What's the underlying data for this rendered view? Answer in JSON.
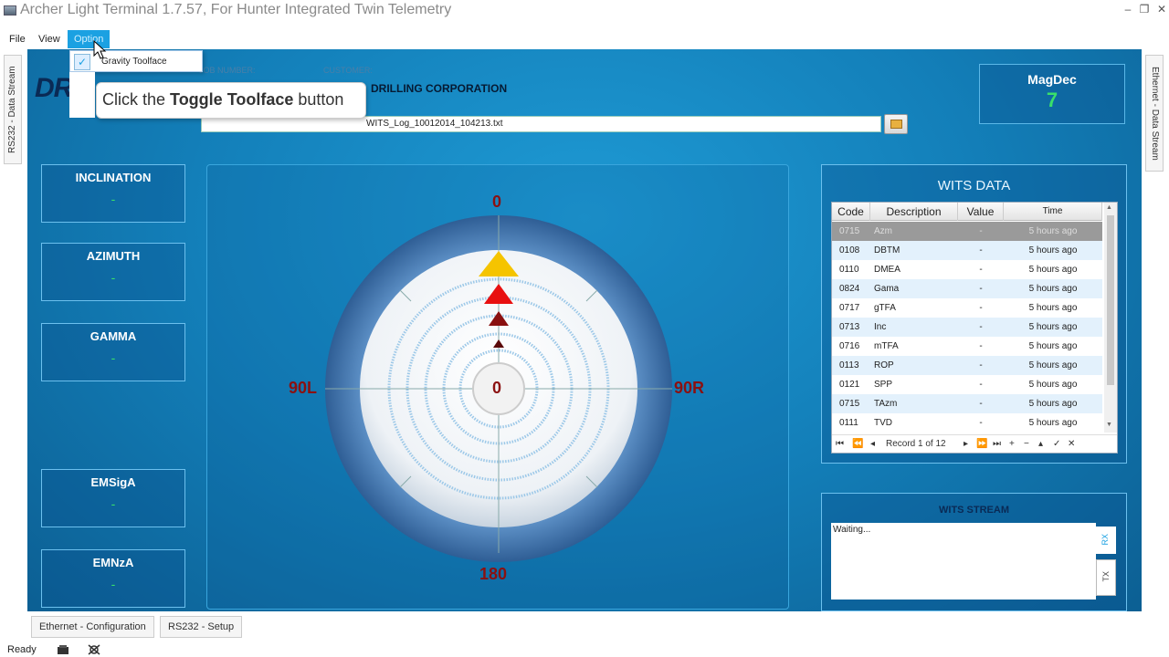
{
  "window": {
    "title": "Archer Light Terminal 1.7.57, For Hunter Integrated Twin Telemetry",
    "controls": [
      "–",
      "❐",
      "✕"
    ]
  },
  "menu": {
    "file": "File",
    "view": "View",
    "option": "Option"
  },
  "option_menu": {
    "item": "Gravity Toolface",
    "checked": true
  },
  "tooltip": {
    "prefix": "Click the ",
    "bold": "Toggle Toolface",
    "suffix": " button"
  },
  "side_tabs": {
    "left": "RS232 - Data Stream",
    "right": "Ethernet - Data Stream"
  },
  "header": {
    "logo_text": "DR",
    "job_number_label": "JOB NUMBER:",
    "customer_label": "CUSTOMER:",
    "customer_value": "DRILLING CORPORATION",
    "log_file": "WITS_Log_10012014_104213.txt"
  },
  "magdec": {
    "label": "MagDec",
    "value": "7"
  },
  "panels": [
    {
      "label": "INCLINATION",
      "value": "-"
    },
    {
      "label": "AZIMUTH",
      "value": "-"
    },
    {
      "label": "GAMMA",
      "value": "-"
    },
    {
      "label": "EMSigA",
      "value": "-"
    },
    {
      "label": "EMNzA",
      "value": "-"
    }
  ],
  "toolface": {
    "top": "0",
    "bottom": "180",
    "left": "90L",
    "right": "90R",
    "center": "0",
    "colors": {
      "yellow": "#f5c400",
      "red": "#e81010",
      "darkred": "#8a1010",
      "maroon": "#5a0a0a"
    }
  },
  "wits": {
    "title": "WITS DATA",
    "columns": {
      "code": "Code",
      "description": "Description",
      "value": "Value",
      "time": "Time"
    },
    "rows": [
      {
        "code": "0715",
        "desc": "Azm",
        "value": "-",
        "time": "5 hours ago"
      },
      {
        "code": "0108",
        "desc": "DBTM",
        "value": "-",
        "time": "5 hours ago"
      },
      {
        "code": "0110",
        "desc": "DMEA",
        "value": "-",
        "time": "5 hours ago"
      },
      {
        "code": "0824",
        "desc": "Gama",
        "value": "-",
        "time": "5 hours ago"
      },
      {
        "code": "0717",
        "desc": "gTFA",
        "value": "-",
        "time": "5 hours ago"
      },
      {
        "code": "0713",
        "desc": "Inc",
        "value": "-",
        "time": "5 hours ago"
      },
      {
        "code": "0716",
        "desc": "mTFA",
        "value": "-",
        "time": "5 hours ago"
      },
      {
        "code": "0113",
        "desc": "ROP",
        "value": "-",
        "time": "5 hours ago"
      },
      {
        "code": "0121",
        "desc": "SPP",
        "value": "-",
        "time": "5 hours ago"
      },
      {
        "code": "0715",
        "desc": "TAzm",
        "value": "-",
        "time": "5 hours ago"
      },
      {
        "code": "0111",
        "desc": "TVD",
        "value": "-",
        "time": "5 hours ago"
      }
    ],
    "pager": {
      "record_text": "Record 1 of 12"
    }
  },
  "stream": {
    "title": "WITS STREAM",
    "text": "Waiting...",
    "rx": "RX",
    "tx": "TX"
  },
  "bottom_tabs": [
    "Ethernet - Configuration",
    "RS232 - Setup"
  ],
  "status": {
    "text": "Ready"
  }
}
